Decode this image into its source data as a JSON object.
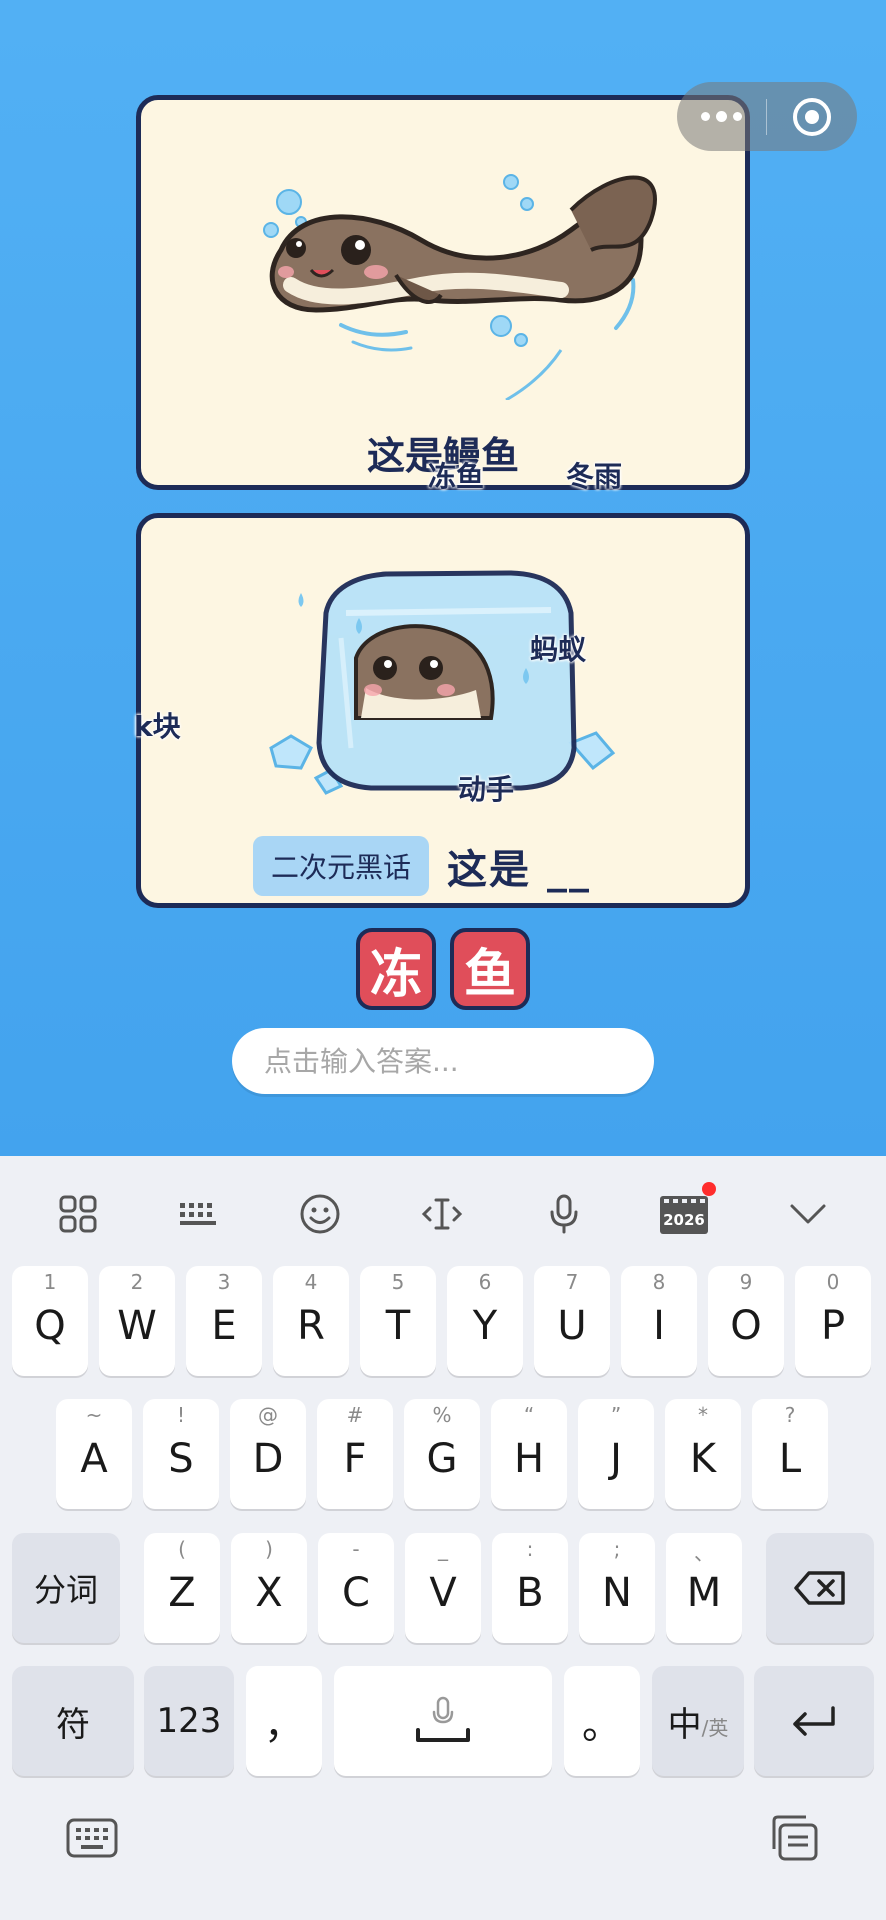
{
  "card1": {
    "caption": "这是鳗鱼"
  },
  "card2": {
    "tag": "二次元黑话",
    "caption": "这是 __"
  },
  "danmu": [
    "冻鱼",
    "冬雨",
    "蚂蚁",
    "k块",
    "动手"
  ],
  "answer_tiles": [
    "冻",
    "鱼"
  ],
  "input": {
    "placeholder": "点击输入答案...",
    "value": ""
  },
  "toolbar": {
    "icons": [
      "apps-grid-icon",
      "keyboard-layout-icon",
      "emoji-icon",
      "cursor-icon",
      "mic-icon",
      "calendar-2026-icon",
      "collapse-chevron-icon"
    ],
    "calendar_label": "2026",
    "badge_color": "#ff2d2d"
  },
  "keyboard": {
    "row1": [
      {
        "k": "Q",
        "s": "1"
      },
      {
        "k": "W",
        "s": "2"
      },
      {
        "k": "E",
        "s": "3"
      },
      {
        "k": "R",
        "s": "4"
      },
      {
        "k": "T",
        "s": "5"
      },
      {
        "k": "Y",
        "s": "6"
      },
      {
        "k": "U",
        "s": "7"
      },
      {
        "k": "I",
        "s": "8"
      },
      {
        "k": "O",
        "s": "9"
      },
      {
        "k": "P",
        "s": "0"
      }
    ],
    "row2": [
      {
        "k": "A",
        "s": "~"
      },
      {
        "k": "S",
        "s": "!"
      },
      {
        "k": "D",
        "s": "@"
      },
      {
        "k": "F",
        "s": "#"
      },
      {
        "k": "G",
        "s": "%"
      },
      {
        "k": "H",
        "s": "“"
      },
      {
        "k": "J",
        "s": "”"
      },
      {
        "k": "K",
        "s": "*"
      },
      {
        "k": "L",
        "s": "?"
      }
    ],
    "row3": [
      {
        "k": "Z",
        "s": "("
      },
      {
        "k": "X",
        "s": ")"
      },
      {
        "k": "C",
        "s": "-"
      },
      {
        "k": "V",
        "s": "_"
      },
      {
        "k": "B",
        "s": ":"
      },
      {
        "k": "N",
        "s": ";"
      },
      {
        "k": "M",
        "s": "、"
      }
    ],
    "fenci": "分词",
    "fu": "符",
    "num": "123",
    "comma": "，",
    "period": "。",
    "zh": "中",
    "en": "/英"
  },
  "colors": {
    "accent_red": "#e04e5a",
    "navy": "#1d2b57",
    "sky": "#4aa8f1"
  }
}
